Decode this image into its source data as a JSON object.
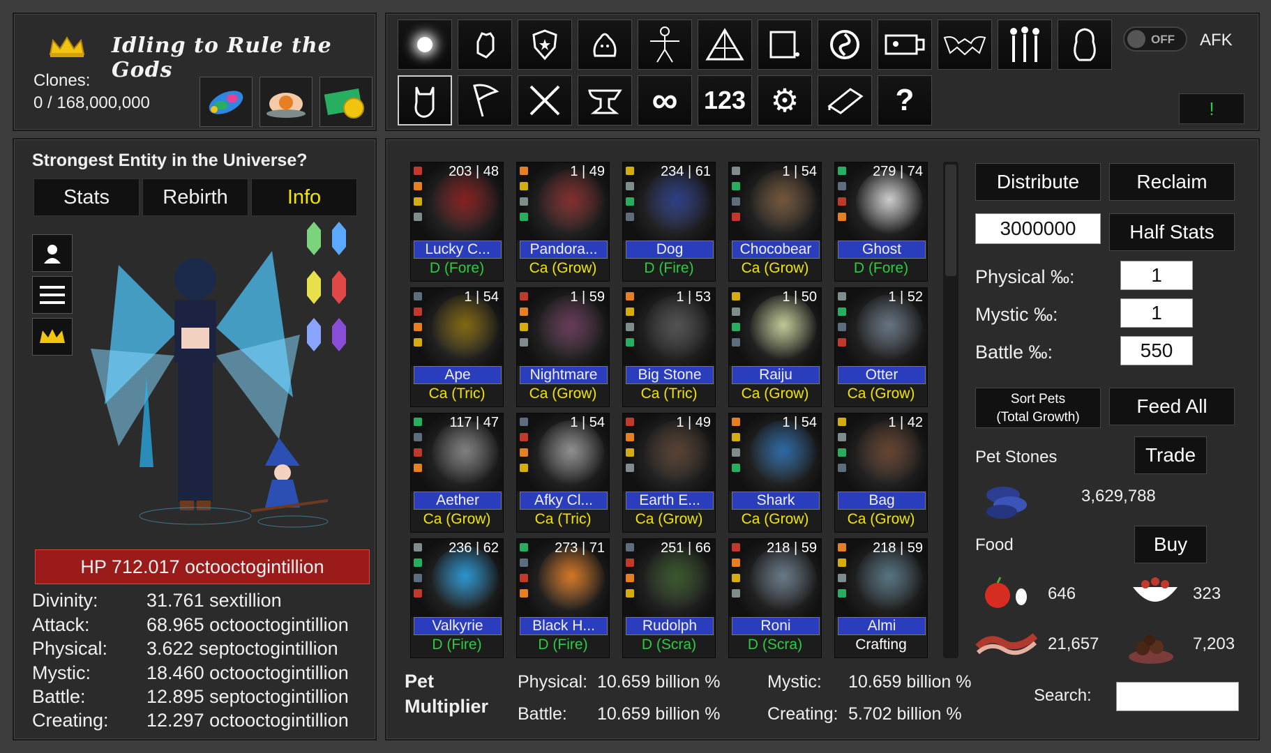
{
  "header": {
    "title": "Idling to Rule the Gods",
    "clones_label": "Clones:",
    "clones_value": "0 / 168,000,000",
    "shop_items": [
      "candy-icon",
      "lotus-icon",
      "gold-coupon-icon"
    ]
  },
  "top_icons_row1": [
    "sun-icon",
    "fist-icon",
    "shield-icon",
    "ghost-blob-icon",
    "body-outline-icon",
    "pyramid-icon",
    "map-icon",
    "spiral-icon",
    "dungeon-icon",
    "bat-icon",
    "people-icon",
    "penguin-icon"
  ],
  "top_icons_row2": [
    "cat-icon",
    "flag-icon",
    "crossed-swords-icon",
    "anvil-icon",
    "infinity-icon",
    "123-icon",
    "gear-icon",
    "book-icon",
    "question-icon"
  ],
  "top_icons_row2_text": {
    "infinity": "∞",
    "numbers": "123",
    "question": "?"
  },
  "afk": {
    "toggle_label": "OFF",
    "label": "AFK"
  },
  "notify_label": "!",
  "left_panel": {
    "title": "Strongest Entity in the Universe?",
    "tabs": [
      "Stats",
      "Rebirth",
      "Info"
    ],
    "active_tab": "Info",
    "hp": "HP 712.017 octooctogintillion",
    "stats": [
      {
        "label": "Divinity:",
        "value": "31.761 sextillion"
      },
      {
        "label": "Attack:",
        "value": "68.965 octooctogintillion"
      },
      {
        "label": "Physical:",
        "value": "3.622 septoctogintillion"
      },
      {
        "label": "Mystic:",
        "value": "18.460 octooctogintillion"
      },
      {
        "label": "Battle:",
        "value": "12.895 septoctogintillion"
      },
      {
        "label": "Creating:",
        "value": "12.297 octooctogintillion"
      }
    ]
  },
  "pets": [
    {
      "name": "Lucky C...",
      "nums": "203 | 48",
      "cls": "D (Fore)",
      "cls_color": "#2ecc40"
    },
    {
      "name": "Pandora...",
      "nums": "1 | 49",
      "cls": "Ca (Grow)",
      "cls_color": "#f2e600"
    },
    {
      "name": "Dog",
      "nums": "234 | 61",
      "cls": "D (Fire)",
      "cls_color": "#2ecc40"
    },
    {
      "name": "Chocobear",
      "nums": "1 | 54",
      "cls": "Ca (Grow)",
      "cls_color": "#f2e600"
    },
    {
      "name": "Ghost",
      "nums": "279 | 74",
      "cls": "D (Fore)",
      "cls_color": "#2ecc40"
    },
    {
      "name": "Ape",
      "nums": "1 | 54",
      "cls": "Ca (Tric)",
      "cls_color": "#f2e600"
    },
    {
      "name": "Nightmare",
      "nums": "1 | 59",
      "cls": "Ca (Grow)",
      "cls_color": "#f2e600"
    },
    {
      "name": "Big Stone",
      "nums": "1 | 53",
      "cls": "Ca (Tric)",
      "cls_color": "#f2e600"
    },
    {
      "name": "Raiju",
      "nums": "1 | 50",
      "cls": "Ca (Grow)",
      "cls_color": "#f2e600"
    },
    {
      "name": "Otter",
      "nums": "1 | 52",
      "cls": "Ca (Grow)",
      "cls_color": "#f2e600"
    },
    {
      "name": "Aether",
      "nums": "117 | 47",
      "cls": "Ca (Grow)",
      "cls_color": "#f2e600"
    },
    {
      "name": "Afky Cl...",
      "nums": "1 | 54",
      "cls": "Ca (Tric)",
      "cls_color": "#f2e600"
    },
    {
      "name": "Earth E...",
      "nums": "1 | 49",
      "cls": "Ca (Grow)",
      "cls_color": "#f2e600"
    },
    {
      "name": "Shark",
      "nums": "1 | 54",
      "cls": "Ca (Grow)",
      "cls_color": "#f2e600"
    },
    {
      "name": "Bag",
      "nums": "1 | 42",
      "cls": "Ca (Grow)",
      "cls_color": "#f2e600"
    },
    {
      "name": "Valkyrie",
      "nums": "236 | 62",
      "cls": "D (Fire)",
      "cls_color": "#2ecc40"
    },
    {
      "name": "Black H...",
      "nums": "273 | 71",
      "cls": "D (Fire)",
      "cls_color": "#2ecc40"
    },
    {
      "name": "Rudolph",
      "nums": "251 | 66",
      "cls": "D (Scra)",
      "cls_color": "#2ecc40"
    },
    {
      "name": "Roni",
      "nums": "218 | 59",
      "cls": "D (Scra)",
      "cls_color": "#2ecc40"
    },
    {
      "name": "Almi",
      "nums": "218 | 59",
      "cls": "Crafting",
      "cls_color": "#ffffff"
    }
  ],
  "multiplier": {
    "label_line1": "Pet",
    "label_line2": "Multiplier",
    "physical_label": "Physical:",
    "physical_value": "10.659 billion %",
    "mystic_label": "Mystic:",
    "mystic_value": "10.659 billion %",
    "battle_label": "Battle:",
    "battle_value": "10.659 billion %",
    "creating_label": "Creating:",
    "creating_value": "5.702 billion %"
  },
  "right_panel": {
    "distribute": "Distribute",
    "reclaim": "Reclaim",
    "amount": "3000000",
    "half_stats": "Half Stats",
    "physical_label": "Physical ‰:",
    "physical_value": "1",
    "mystic_label": "Mystic ‰:",
    "mystic_value": "1",
    "battle_label": "Battle ‰:",
    "battle_value": "550",
    "sort_line1": "Sort Pets",
    "sort_line2": "(Total Growth)",
    "feed_all": "Feed All",
    "pet_stones_label": "Pet Stones",
    "trade": "Trade",
    "pet_stones_value": "3,629,788",
    "food_label": "Food",
    "buy": "Buy",
    "food": [
      {
        "icon": "apple-icon",
        "value": "646"
      },
      {
        "icon": "berry-bowl-icon",
        "value": "323"
      },
      {
        "icon": "bacon-icon",
        "value": "21,657"
      },
      {
        "icon": "chocolate-icon",
        "value": "7,203"
      }
    ],
    "search_label": "Search:",
    "search_value": ""
  },
  "colors": {
    "accent": "#f2e600",
    "name_bar": "#2a3dbd",
    "hp_bar": "#9b1b1b",
    "good": "#2ecc40"
  }
}
